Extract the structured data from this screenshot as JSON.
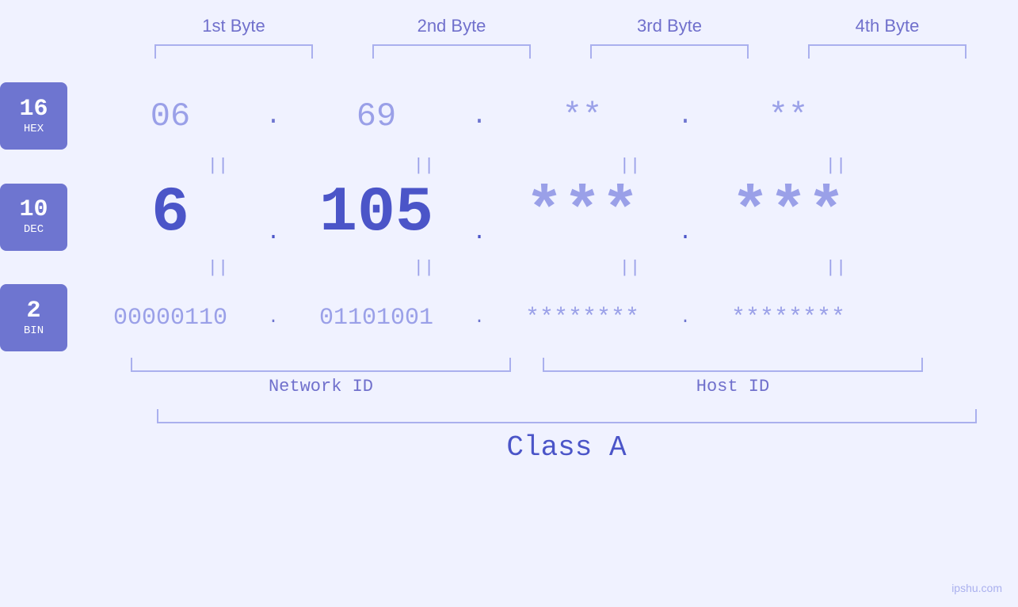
{
  "byteHeaders": [
    {
      "label": "1st Byte"
    },
    {
      "label": "2nd Byte"
    },
    {
      "label": "3rd Byte"
    },
    {
      "label": "4th Byte"
    }
  ],
  "rows": {
    "hex": {
      "badge": {
        "number": "16",
        "label": "HEX"
      },
      "values": [
        "06",
        "69",
        "**",
        "**"
      ],
      "dots": [
        ".",
        ".",
        "."
      ]
    },
    "dec": {
      "badge": {
        "number": "10",
        "label": "DEC"
      },
      "values": [
        "6",
        "105.",
        "***.",
        "***"
      ],
      "dots": [
        ".",
        ".",
        "."
      ]
    },
    "bin": {
      "badge": {
        "number": "2",
        "label": "BIN"
      },
      "values": [
        "00000110",
        "01101001",
        "********",
        "********"
      ],
      "dots": [
        ".",
        ".",
        "."
      ]
    }
  },
  "labels": {
    "networkId": "Network ID",
    "hostId": "Host ID",
    "classLabel": "Class A"
  },
  "watermark": "ipshu.com"
}
